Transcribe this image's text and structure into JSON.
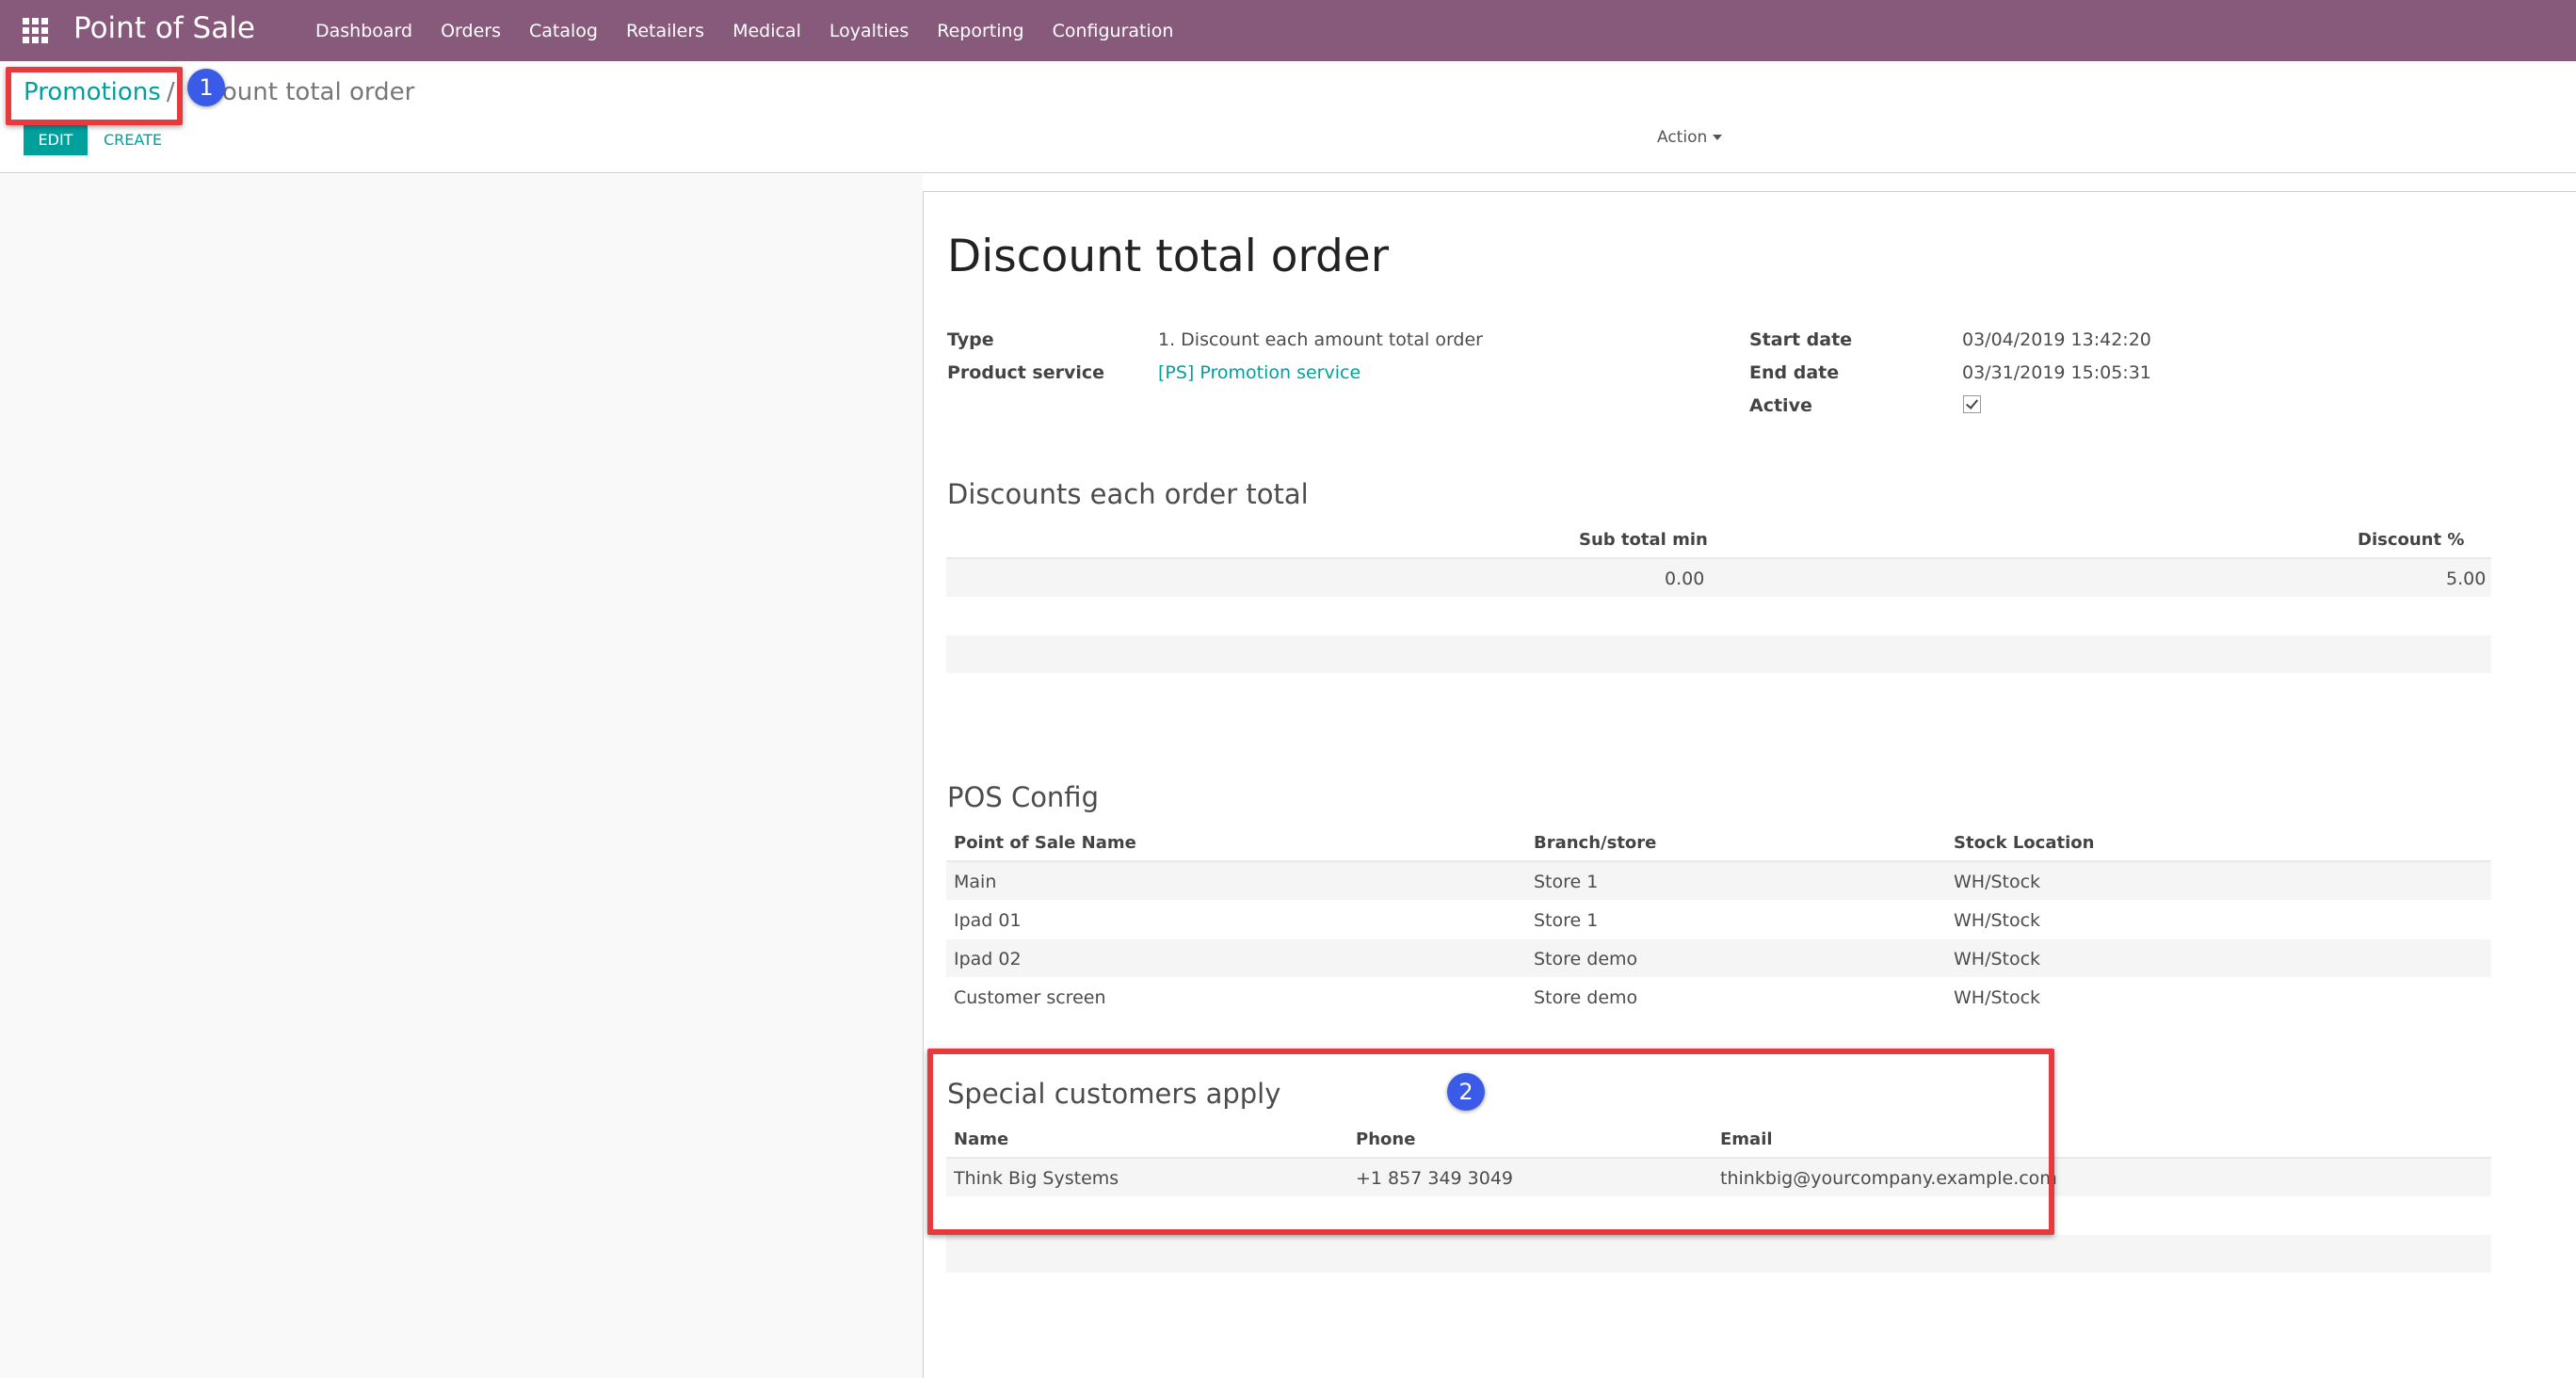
{
  "app": {
    "title": "Point of Sale",
    "menu": [
      "Dashboard",
      "Orders",
      "Catalog",
      "Retailers",
      "Medical",
      "Loyalties",
      "Reporting",
      "Configuration"
    ]
  },
  "control_panel": {
    "breadcrumb_parent": "Promotions",
    "breadcrumb_separator": "/",
    "breadcrumb_current": "count total order",
    "edit_label": "EDIT",
    "create_label": "CREATE",
    "action_label": "Action"
  },
  "annotations": {
    "badge1": "1",
    "badge2": "2"
  },
  "record": {
    "title": "Discount total order",
    "type_label": "Type",
    "type_value": "1. Discount each amount total order",
    "product_service_label": "Product service",
    "product_service_value": "[PS] Promotion service",
    "start_date_label": "Start date",
    "start_date_value": "03/04/2019 13:42:20",
    "end_date_label": "End date",
    "end_date_value": "03/31/2019 15:05:31",
    "active_label": "Active",
    "active_checked": true
  },
  "discounts": {
    "title": "Discounts each order total",
    "columns": [
      "Sub total min",
      "Discount %"
    ],
    "rows": [
      [
        "0.00",
        "5.00"
      ]
    ]
  },
  "pos_config": {
    "title": "POS Config",
    "columns": [
      "Point of Sale Name",
      "Branch/store",
      "Stock Location"
    ],
    "rows": [
      [
        "Main",
        "Store 1",
        "WH/Stock"
      ],
      [
        "Ipad 01",
        "Store 1",
        "WH/Stock"
      ],
      [
        "Ipad 02",
        "Store demo",
        "WH/Stock"
      ],
      [
        "Customer screen",
        "Store demo",
        "WH/Stock"
      ]
    ]
  },
  "special_customers": {
    "title": "Special customers apply",
    "columns": [
      "Name",
      "Phone",
      "Email"
    ],
    "rows": [
      [
        "Think Big Systems",
        "+1 857 349 3049",
        "thinkbig@yourcompany.example.com"
      ]
    ]
  },
  "colors": {
    "navbar": "#875a7b",
    "accent": "#00a09d",
    "annotation_box": "#e8393f",
    "annotation_badge": "#3a5ae8"
  }
}
